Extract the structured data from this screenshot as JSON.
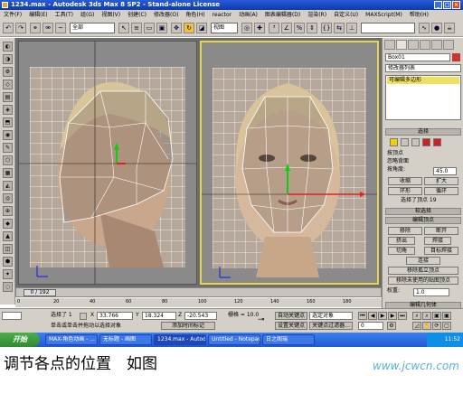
{
  "window": {
    "title": "1234.max - Autodesk 3ds Max 8 SP2 - Stand-alone License",
    "buttons": [
      "_",
      "□",
      "×"
    ]
  },
  "menu": {
    "items": [
      "文件(F)",
      "编辑(E)",
      "工具(T)",
      "组(G)",
      "视图(V)",
      "创建(C)",
      "修改器(O)",
      "角色(H)",
      "reactor",
      "动画(A)",
      "图表编辑器(D)",
      "渲染(R)",
      "自定义(U)",
      "MAXScript(M)",
      "帮助(H)"
    ]
  },
  "toolbar": {
    "selection_filter": "全部",
    "reference_coord": "视图"
  },
  "viewports": [
    {
      "label": ""
    },
    {
      "label": ""
    }
  ],
  "command_panel": {
    "object_name": "Box01",
    "modifier_list": "修改器列表",
    "stack_item": "可编辑多边形",
    "selection_title": "选择",
    "by_vertex": "按顶点",
    "ignore_backfacing": "忽略背面",
    "by_angle": "按角度:",
    "angle_value": "45.0",
    "shrink": "收缩",
    "grow": "扩大",
    "ring": "环形",
    "loop": "循环",
    "selected_status": "选择了顶点 19",
    "soft_selection": "软选择",
    "edit_vertices": "编辑顶点",
    "remove": "移除",
    "break": "断开",
    "extrude": "挤出",
    "weld": "焊接",
    "chamfer": "切角",
    "target_weld": "目标焊接",
    "connect": "连接",
    "remove_isolated": "移除孤立顶点",
    "remove_unused_map": "移除未使用的贴图顶点",
    "weight_label": "权重:",
    "weight_value": "1.0",
    "edit_geometry": "编辑几何体"
  },
  "timeline": {
    "frame_display": "0 / 192",
    "ticks": [
      "0",
      "20",
      "40",
      "60",
      "80",
      "100",
      "120",
      "140",
      "160",
      "180"
    ]
  },
  "status": {
    "selected": "选择了 1",
    "x_value": "33.766",
    "y_value": "18.324",
    "z_value": "-20.543",
    "grid": "栅格 = 10.0",
    "auto_key": "自动关键点",
    "key_filter_set": "选定对象",
    "set_key": "设置关键点",
    "key_filters": "关键点过滤器...",
    "prompt": "单击或单击并拖动以选择对象",
    "add_time_tag": "添加时间标记",
    "frame_value": "0"
  },
  "taskbar": {
    "start": "开始",
    "tasks": [
      "MAX-角色动画 - ...",
      "无标题 - 画图",
      "1234.max - Autod...",
      "Untitled - Notepad",
      "日之阁瑞"
    ],
    "clock": "11:52"
  },
  "caption": "调节各点的位置　如图",
  "watermark": "www.jcwcn.com"
}
